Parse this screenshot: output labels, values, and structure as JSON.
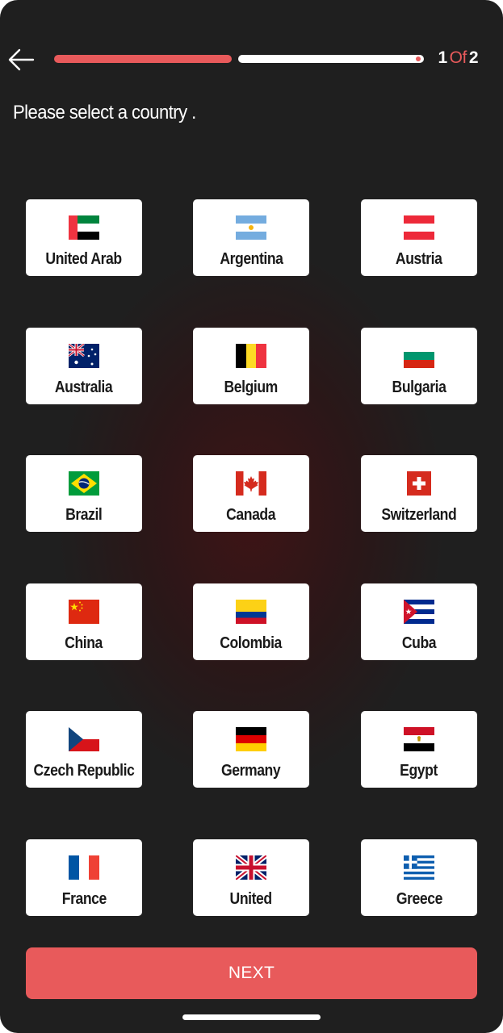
{
  "header": {
    "progress_fraction": 0.5,
    "step_current": "1",
    "step_of": "Of",
    "step_total": "2"
  },
  "prompt": "Please select a country .",
  "countries": [
    {
      "name": "United Arab",
      "flag": "ae-flag-icon"
    },
    {
      "name": "Argentina",
      "flag": "ar-flag-icon"
    },
    {
      "name": "Austria",
      "flag": "at-flag-icon"
    },
    {
      "name": "Australia",
      "flag": "au-flag-icon"
    },
    {
      "name": "Belgium",
      "flag": "be-flag-icon"
    },
    {
      "name": "Bulgaria",
      "flag": "bg-flag-icon"
    },
    {
      "name": "Brazil",
      "flag": "br-flag-icon"
    },
    {
      "name": "Canada",
      "flag": "ca-flag-icon"
    },
    {
      "name": "Switzerland",
      "flag": "ch-flag-icon"
    },
    {
      "name": "China",
      "flag": "cn-flag-icon"
    },
    {
      "name": "Colombia",
      "flag": "co-flag-icon"
    },
    {
      "name": "Cuba",
      "flag": "cu-flag-icon"
    },
    {
      "name": "Czech Republic",
      "flag": "cz-flag-icon"
    },
    {
      "name": "Germany",
      "flag": "de-flag-icon"
    },
    {
      "name": "Egypt",
      "flag": "eg-flag-icon"
    },
    {
      "name": "France",
      "flag": "fr-flag-icon"
    },
    {
      "name": "United",
      "flag": "gb-flag-icon"
    },
    {
      "name": "Greece",
      "flag": "gr-flag-icon"
    }
  ],
  "next_label": "NEXT",
  "colors": {
    "accent": "#e85a5b",
    "background": "#1f1f1f",
    "card": "#ffffff",
    "text_dark": "#1a1a1a"
  }
}
